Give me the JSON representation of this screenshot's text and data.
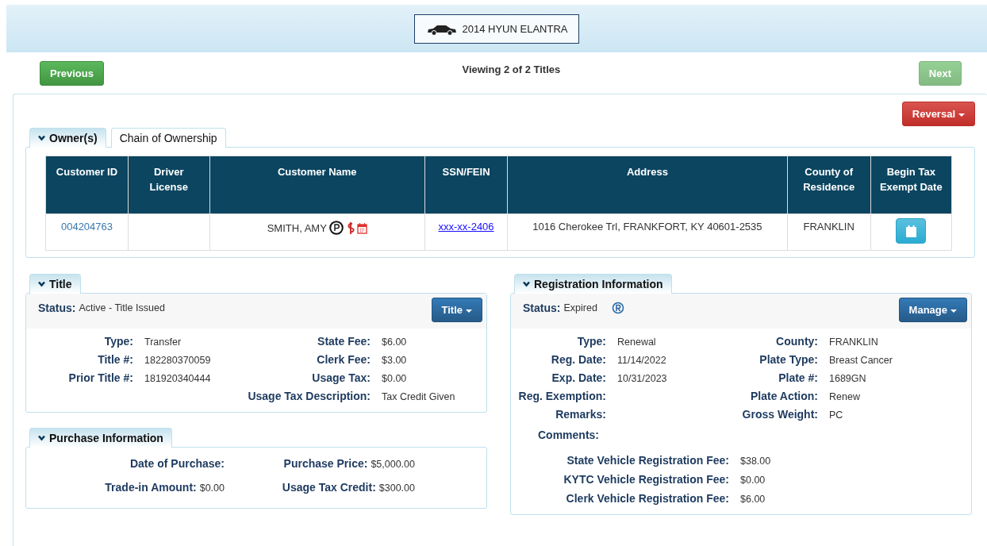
{
  "vehicle": {
    "label": "2014 HYUN ELANTRA"
  },
  "nav": {
    "previous": {
      "label": "Previous",
      "disabled": false
    },
    "viewing": "Viewing 2 of 2 Titles",
    "next": {
      "label": "Next",
      "disabled": true
    }
  },
  "reversal_button": "Reversal",
  "tabs": [
    {
      "label": "Owner(s)",
      "selected": true
    },
    {
      "label": "Chain of Ownership",
      "selected": false
    }
  ],
  "owners_table": {
    "columns": [
      "Customer ID",
      "Driver License",
      "Customer Name",
      "SSN/FEIN",
      "Address",
      "County of Residence",
      "Begin Tax Exempt Date"
    ],
    "rows": [
      {
        "customer_id": "004204763",
        "customer_name": "SMITH, AMY",
        "ssn_fein": "xxx-xx-2406",
        "address": "1016 Cherokee Trl, FRANKFORT, KY 40601-2535",
        "county": "FRANKLIN"
      }
    ]
  },
  "title_section": {
    "heading": "Title",
    "status_label": "Status:",
    "status": "Active - Title Issued",
    "menu_button": "Title",
    "left_fields": [
      {
        "label": "Type:",
        "value": "Transfer"
      },
      {
        "label": "Title #:",
        "value": "182280370059"
      },
      {
        "label": "Prior Title #:",
        "value": "181920340444"
      }
    ],
    "right_fields": [
      {
        "label": "State Fee:",
        "value": "$6.00"
      },
      {
        "label": "Clerk Fee:",
        "value": "$3.00"
      },
      {
        "label": "Usage Tax:",
        "value": "$0.00"
      },
      {
        "label": "Usage Tax Description:",
        "value": "Tax Credit Given"
      }
    ]
  },
  "purchase_section": {
    "heading": "Purchase Information",
    "fields": [
      {
        "label": "Date of Purchase:"
      },
      {
        "label": "Purchase Price:",
        "value": "$5,000.00"
      },
      {
        "label": "Trade-in Amount:",
        "value": "$0.00"
      },
      {
        "label": "Usage Tax Credit:",
        "value": "$300.00"
      }
    ]
  },
  "registration_section": {
    "heading": "Registration Information",
    "status_label": "Status:",
    "status": "Expired",
    "menu_button": "Manage",
    "left_fields": [
      {
        "label": "Type:",
        "value": "Renewal"
      },
      {
        "label": "Reg. Date:",
        "value": "11/14/2022"
      },
      {
        "label": "Exp. Date:",
        "value": "10/31/2023"
      },
      {
        "label": "Reg. Exemption:"
      },
      {
        "label": "Remarks:"
      }
    ],
    "right_fields": [
      {
        "label": "County:",
        "value": "FRANKLIN"
      },
      {
        "label": "Plate Type:",
        "value": "Breast Cancer"
      },
      {
        "label": "Plate #:",
        "value": "1689GN"
      },
      {
        "label": "Plate Action:",
        "value": "Renew"
      },
      {
        "label": "Gross Weight:",
        "value": "PC"
      }
    ],
    "comments_label": "Comments:",
    "fees": [
      {
        "label": "State Vehicle Registration Fee:",
        "value": "$38.00"
      },
      {
        "label": "KYTC Vehicle Registration Fee:",
        "value": "$0.00"
      },
      {
        "label": "Clerk Vehicle Registration Fee:",
        "value": "$6.00"
      }
    ]
  }
}
